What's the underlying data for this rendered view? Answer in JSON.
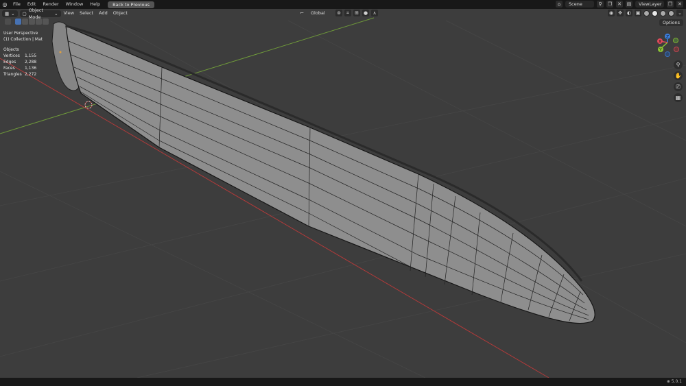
{
  "topbar": {
    "menus": [
      "File",
      "Edit",
      "Render",
      "Window",
      "Help"
    ],
    "back_label": "Back to Previous",
    "scene_label": "Scene",
    "viewlayer_label": "ViewLayer"
  },
  "header": {
    "mode_label": "Object Mode",
    "menus": [
      "View",
      "Select",
      "Add",
      "Object"
    ],
    "orientation_label": "Global",
    "options_label": "Options"
  },
  "overlay": {
    "view_name": "User Perspective",
    "collection": "(1) Collection | Mat"
  },
  "stats": {
    "objects_label": "Objects",
    "rows": [
      {
        "label": "Vertices",
        "value": "1,155"
      },
      {
        "label": "Edges",
        "value": "2,288"
      },
      {
        "label": "Faces",
        "value": "1,136"
      },
      {
        "label": "Triangles",
        "value": "2,272"
      }
    ]
  },
  "gizmo": {
    "axes": [
      "Z",
      "X",
      "Y"
    ],
    "colors": {
      "x": "#e04a5b",
      "y": "#8ec533",
      "z": "#3b7fe0"
    }
  },
  "statusbar": {
    "version": "5.0.1"
  },
  "colors": {
    "grid_bg": "#3d3d3d",
    "mesh_fill": "#8c8c8c",
    "wire": "#1a1a1a"
  }
}
